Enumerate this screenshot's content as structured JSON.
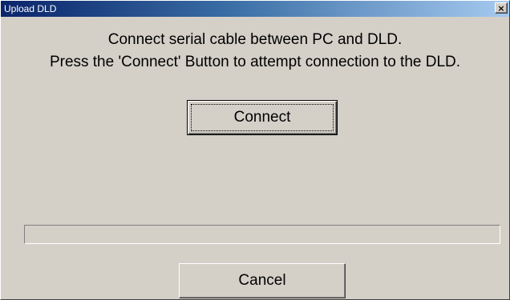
{
  "window": {
    "title": "Upload DLD",
    "close_glyph": "×"
  },
  "message": {
    "line1": "Connect serial cable between PC and DLD.",
    "line2": "Press the 'Connect' Button to attempt connection to the DLD."
  },
  "buttons": {
    "connect_label": "Connect",
    "cancel_label": "Cancel"
  },
  "progress": {
    "value_fraction": 0
  },
  "colors": {
    "dialog_background": "#d4d0c8",
    "titlebar_start": "#0a246a",
    "titlebar_end": "#a6caf0",
    "title_text": "#ffffff"
  },
  "icons": {
    "close": "close-icon"
  }
}
